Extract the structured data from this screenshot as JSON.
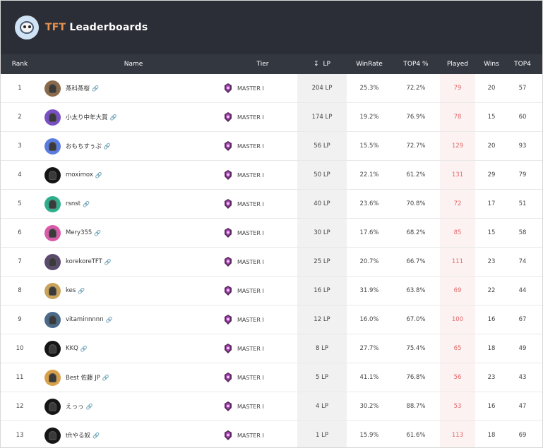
{
  "app": {
    "title_accent": "TFT",
    "title_main": "Leaderboards",
    "logo_icon": "penguin-mascot-icon"
  },
  "colors": {
    "header_bg": "#2b2e36",
    "table_header_bg": "#33373f",
    "accent": "#e8924c",
    "played_text": "#e2686a"
  },
  "columns": {
    "rank": "Rank",
    "name": "Name",
    "tier": "Tier",
    "lp": "LP",
    "lp_sort_icon": "sort-descending-icon",
    "winrate": "WinRate",
    "top4_pct": "TOP4 %",
    "played": "Played",
    "wins": "Wins",
    "top4": "TOP4"
  },
  "rows": [
    {
      "rank": "1",
      "name": "蒸科蒸桜",
      "tier": "MASTER I",
      "lp": "204 LP",
      "winrate": "25.3%",
      "top4_pct": "72.2%",
      "played": "79",
      "wins": "20",
      "top4": "57",
      "avatar_color": "#8a6a4a"
    },
    {
      "rank": "2",
      "name": "小太り中年大賞",
      "tier": "MASTER I",
      "lp": "174 LP",
      "winrate": "19.2%",
      "top4_pct": "76.9%",
      "played": "78",
      "wins": "15",
      "top4": "60",
      "avatar_color": "#7a4fc4"
    },
    {
      "rank": "3",
      "name": "おもちすぅぷ",
      "tier": "MASTER I",
      "lp": "56 LP",
      "winrate": "15.5%",
      "top4_pct": "72.7%",
      "played": "129",
      "wins": "20",
      "top4": "93",
      "avatar_color": "#5a7be0"
    },
    {
      "rank": "4",
      "name": "moximox",
      "tier": "MASTER I",
      "lp": "50 LP",
      "winrate": "22.1%",
      "top4_pct": "61.2%",
      "played": "131",
      "wins": "29",
      "top4": "79",
      "avatar_color": "#151515"
    },
    {
      "rank": "5",
      "name": "rsnst",
      "tier": "MASTER I",
      "lp": "40 LP",
      "winrate": "23.6%",
      "top4_pct": "70.8%",
      "played": "72",
      "wins": "17",
      "top4": "51",
      "avatar_color": "#2fae8c"
    },
    {
      "rank": "6",
      "name": "Mery355",
      "tier": "MASTER I",
      "lp": "30 LP",
      "winrate": "17.6%",
      "top4_pct": "68.2%",
      "played": "85",
      "wins": "15",
      "top4": "58",
      "avatar_color": "#d85aa8"
    },
    {
      "rank": "7",
      "name": "korekoreTFT",
      "tier": "MASTER I",
      "lp": "25 LP",
      "winrate": "20.7%",
      "top4_pct": "66.7%",
      "played": "111",
      "wins": "23",
      "top4": "74",
      "avatar_color": "#5a4a6e"
    },
    {
      "rank": "8",
      "name": "kes",
      "tier": "MASTER I",
      "lp": "16 LP",
      "winrate": "31.9%",
      "top4_pct": "63.8%",
      "played": "69",
      "wins": "22",
      "top4": "44",
      "avatar_color": "#c9a35a"
    },
    {
      "rank": "9",
      "name": "vitaminnnnn",
      "tier": "MASTER I",
      "lp": "12 LP",
      "winrate": "16.0%",
      "top4_pct": "67.0%",
      "played": "100",
      "wins": "16",
      "top4": "67",
      "avatar_color": "#4a6a8a"
    },
    {
      "rank": "10",
      "name": "KKQ",
      "tier": "MASTER I",
      "lp": "8 LP",
      "winrate": "27.7%",
      "top4_pct": "75.4%",
      "played": "65",
      "wins": "18",
      "top4": "49",
      "avatar_color": "#151515"
    },
    {
      "rank": "11",
      "name": "Best 佐藤 JP",
      "tier": "MASTER I",
      "lp": "5 LP",
      "winrate": "41.1%",
      "top4_pct": "76.8%",
      "played": "56",
      "wins": "23",
      "top4": "43",
      "avatar_color": "#d8a04a"
    },
    {
      "rank": "12",
      "name": "えっっ",
      "tier": "MASTER I",
      "lp": "4 LP",
      "winrate": "30.2%",
      "top4_pct": "88.7%",
      "played": "53",
      "wins": "16",
      "top4": "47",
      "avatar_color": "#151515"
    },
    {
      "rank": "13",
      "name": "tftやる奴",
      "tier": "MASTER I",
      "lp": "1 LP",
      "winrate": "15.9%",
      "top4_pct": "61.6%",
      "played": "113",
      "wins": "18",
      "top4": "69",
      "avatar_color": "#151515"
    }
  ]
}
